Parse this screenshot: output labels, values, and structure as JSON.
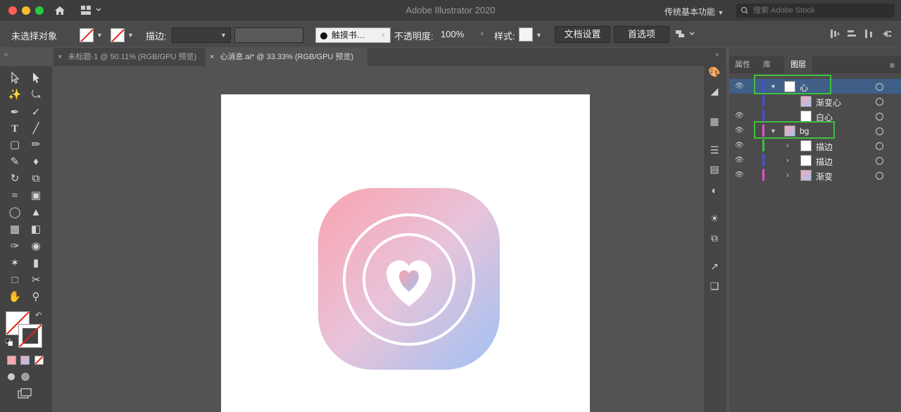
{
  "window": {
    "title": "Adobe Illustrator 2020",
    "workspace": "传统基本功能",
    "search_placeholder": "搜索 Adobe Stock"
  },
  "controlbar": {
    "selection_status": "未选择对象",
    "stroke_label": "描边:",
    "brush_label": "触摸书…",
    "opacity_label": "不透明度:",
    "opacity_value": "100%",
    "style_label": "样式:",
    "doc_setup_button": "文档设置",
    "prefs_button": "首选项"
  },
  "tabs": [
    {
      "label": "未标题-1 @ 50.11% (RGB/GPU 预览)",
      "active": false
    },
    {
      "label": "心消息.ai* @ 33.33% (RGB/GPU 预览)",
      "active": true
    }
  ],
  "panel": {
    "tabs": [
      "属性",
      "库",
      "图层"
    ],
    "active_tab": "图层",
    "layers": [
      {
        "name": "心",
        "level": 0,
        "expanded": true,
        "color": "#4a4ae8"
      },
      {
        "name": "渐变心",
        "level": 1,
        "color": "#4a4ae8"
      },
      {
        "name": "白心",
        "level": 1,
        "color": "#4a4ae8"
      },
      {
        "name": "bg",
        "level": 0,
        "expanded": true,
        "color": "#e84ad6"
      },
      {
        "name": "描边",
        "level": 1,
        "color": "#3fbf3f"
      },
      {
        "name": "描边",
        "level": 1,
        "color": "#4a4ae8"
      },
      {
        "name": "渐变",
        "level": 1,
        "color": "#e84ad6"
      }
    ]
  },
  "colors": {
    "accent_highlight": "#3fbf3f",
    "icon_grad_top": "#f7a8b4",
    "icon_grad_bottom": "#a8c4f2"
  }
}
